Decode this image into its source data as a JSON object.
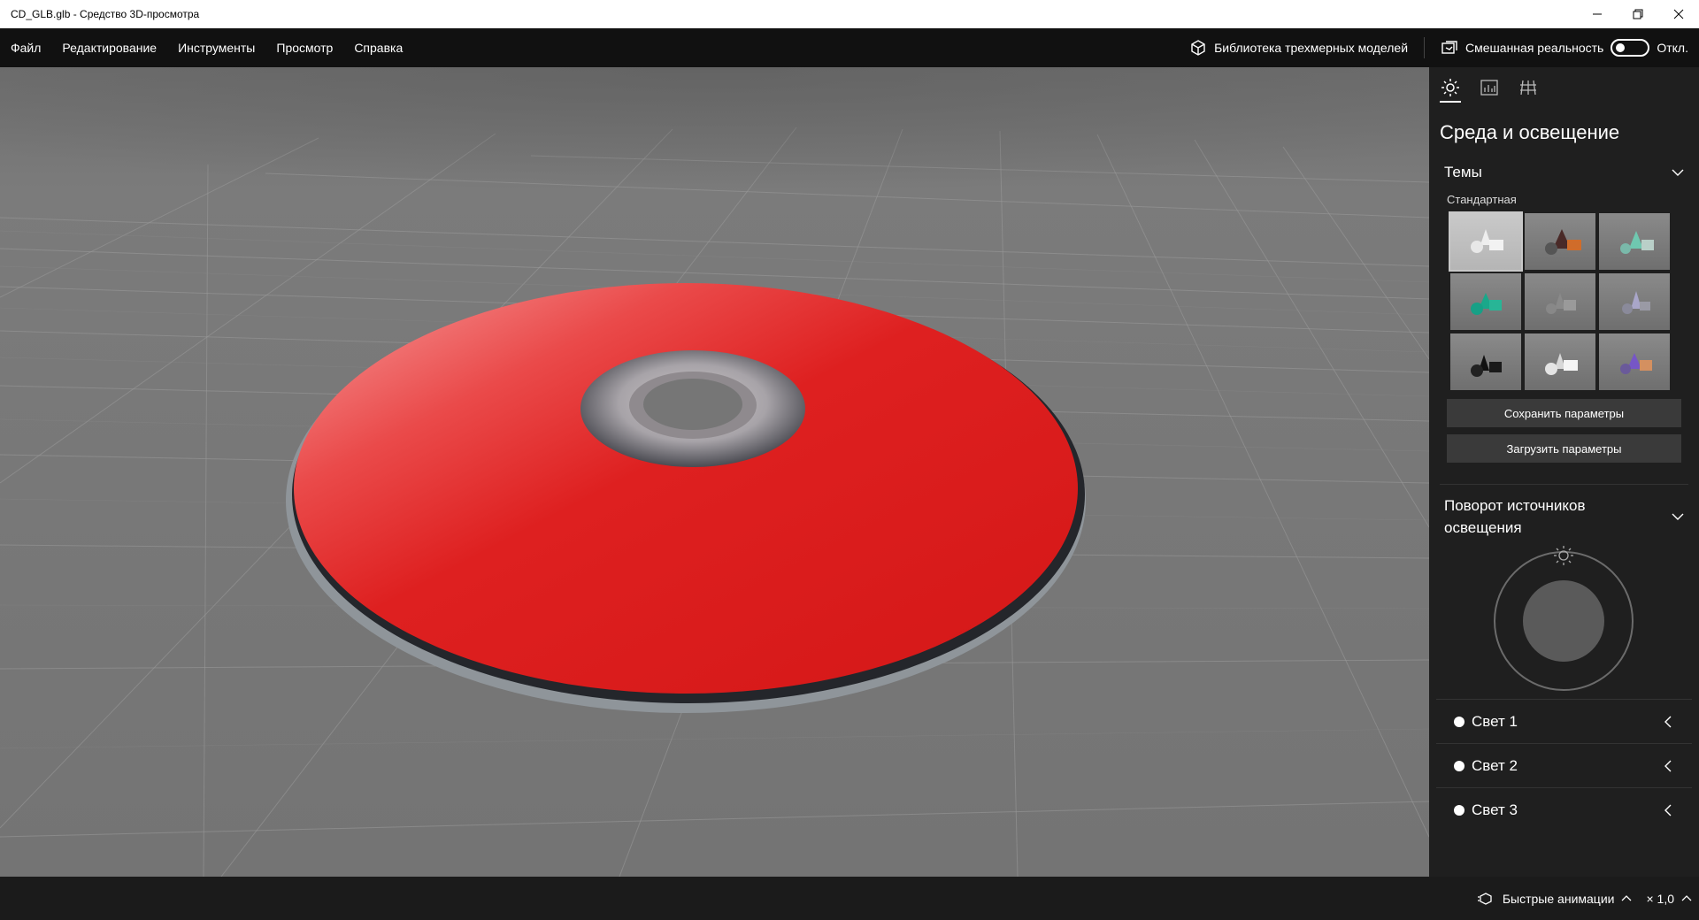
{
  "window": {
    "title": "CD_GLB.glb - Средство 3D-просмотра",
    "icons": [
      "minimize-icon",
      "restore-icon",
      "close-icon"
    ]
  },
  "menu": {
    "items": [
      "Файл",
      "Редактирование",
      "Инструменты",
      "Просмотр",
      "Справка"
    ],
    "library_label": "Библиотека трехмерных моделей",
    "mixed_reality_label": "Смешанная реальность",
    "toggle_state": "Откл."
  },
  "panel": {
    "tabs": [
      "environment-lighting-icon",
      "stats-icon",
      "grid-icon"
    ],
    "title": "Среда и освещение",
    "themes_label": "Темы",
    "themes_sub": "Стандартная",
    "save_label": "Сохранить параметры",
    "load_label": "Загрузить параметры",
    "rotation_label_1": "Поворот источников",
    "rotation_label_2": "освещения",
    "lights": [
      "Свет 1",
      "Свет 2",
      "Свет 3"
    ]
  },
  "status": {
    "animations_label": "Быстрые анимации",
    "speed": "× 1,0"
  },
  "colors": {
    "accent_disc": "#d81c1c",
    "viewport_bg": "#737373"
  }
}
